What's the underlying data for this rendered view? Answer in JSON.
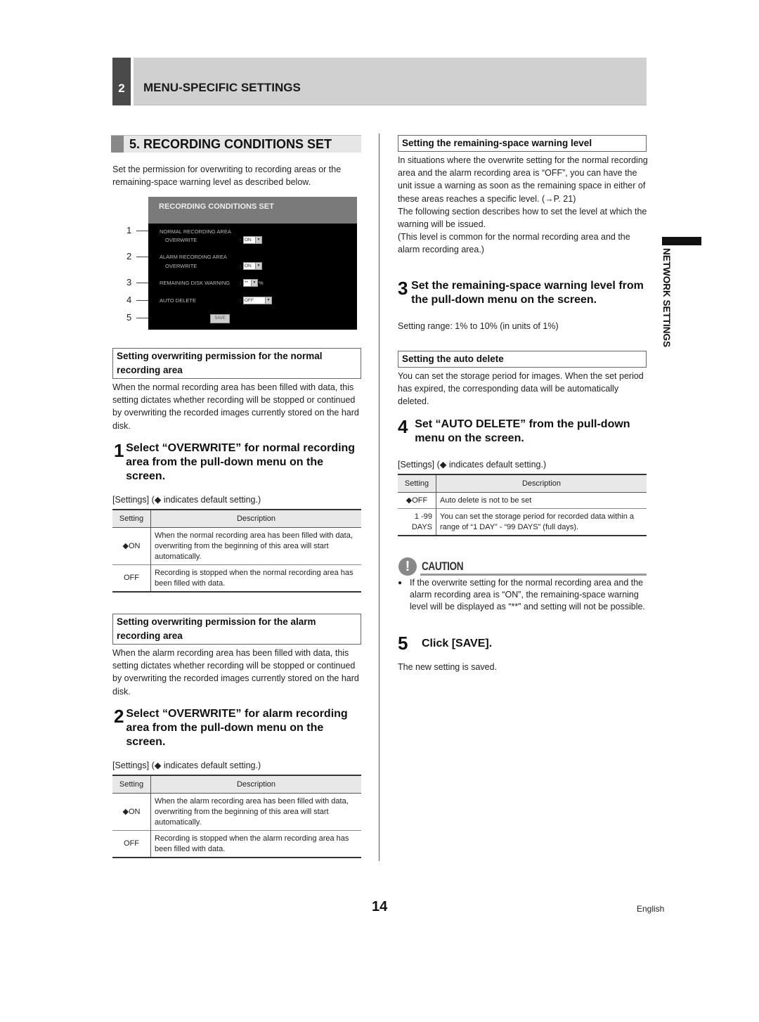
{
  "chapter": {
    "number": "2",
    "title": "MENU-SPECIFIC SETTINGS"
  },
  "section": {
    "title": "5. RECORDING CONDITIONS SET"
  },
  "intro": "Set the permission for overwriting to recording areas or the remaining-space warning level as described below.",
  "screen": {
    "title": "RECORDING CONDITIONS SET",
    "callouts": [
      "1",
      "2",
      "3",
      "4",
      "5"
    ],
    "normal_area_label": "NORMAL RECORDING AREA",
    "normal_overwrite_label": "OVERWRITE",
    "normal_overwrite_value": "ON",
    "alarm_area_label": "ALARM RECORDING AREA",
    "alarm_overwrite_label": "OVERWRITE",
    "alarm_overwrite_value": "ON",
    "disk_warning_label": "REMAINING DISK WARNING",
    "disk_warning_value": "**",
    "disk_warning_unit": "%",
    "auto_delete_label": "AUTO DELETE",
    "auto_delete_value": "OFF",
    "colon": ":",
    "save_label": "SAVE",
    "dropdown_arrow": "▼"
  },
  "normal": {
    "heading": "Setting overwriting permission for the normal recording area",
    "body": "When the normal recording area has been filled with data, this setting dictates whether recording will be stopped or continued by overwriting the recorded images currently stored on the hard disk.",
    "step_num": "1",
    "step_text": "Select “OVERWRITE” for normal recording area from the pull-down menu on the screen.",
    "settings_note": "[Settings] (◆ indicates default setting.)",
    "table": {
      "headers": [
        "Setting",
        "Description"
      ],
      "rows": [
        {
          "setting": "◆ON",
          "desc": "When the normal recording area has been filled with data, overwriting from the beginning of this area will start automatically."
        },
        {
          "setting": "OFF",
          "desc": "Recording is stopped when the normal recording area has been filled with data."
        }
      ]
    }
  },
  "alarm": {
    "heading": "Setting overwriting permission for the alarm recording area",
    "body": "When the alarm recording area has been filled with data, this setting dictates whether recording will be stopped or continued by overwriting the recorded images currently stored on the hard disk.",
    "step_num": "2",
    "step_text": "Select “OVERWRITE” for alarm recording area from the pull-down menu on the screen.",
    "settings_note": "[Settings] (◆ indicates default setting.)",
    "table": {
      "headers": [
        "Setting",
        "Description"
      ],
      "rows": [
        {
          "setting": "◆ON",
          "desc": "When the alarm recording area has been filled with data, overwriting from the beginning of this area will start automatically."
        },
        {
          "setting": "OFF",
          "desc": "Recording is stopped when the alarm recording area has been filled with data."
        }
      ]
    }
  },
  "warning": {
    "heading": "Setting the remaining-space warning level",
    "body1": "In situations where the overwrite setting for the normal recording area and the alarm recording area is “OFF”, you can have the unit issue a warning as soon as the remaining space in either of these areas reaches a specific level. (→P. 21)",
    "body2": "The following section describes how to set the level at which the warning will be issued.",
    "body3": "(This level is common for the normal recording area and the alarm recording area.)",
    "step_num": "3",
    "step_text": "Set the remaining-space warning level from the pull-down menu on the screen.",
    "range": "Setting range: 1% to 10% (in units of 1%)"
  },
  "autodelete": {
    "heading": "Setting the auto delete",
    "body": "You can set the storage period for images. When the set period has expired, the corresponding data will be automatically deleted.",
    "step_num": "4",
    "step_text": "Set “AUTO DELETE” from the pull-down menu on the screen.",
    "settings_note": "[Settings] (◆ indicates default setting.)",
    "table": {
      "headers": [
        "Setting",
        "Description"
      ],
      "rows": [
        {
          "setting": "◆OFF",
          "desc": "Auto delete is not to be set"
        },
        {
          "setting": "1 -99 DAYS",
          "desc": "You can set the storage period for recorded data within a range of  “1 DAY” - “99 DAYS” (full days)."
        }
      ]
    }
  },
  "caution": {
    "icon": "!",
    "label": "CAUTION",
    "bullet": "●",
    "text": "If the overwrite setting for the normal recording area and the alarm recording area is “ON”, the remaining-space warning level will be displayed as “**” and setting will not be possible."
  },
  "save_step": {
    "step_num": "5",
    "step_text": "Click [SAVE].",
    "body": "The new setting is saved."
  },
  "side_tab": {
    "line1": "NETWORK",
    "line2": "SETTINGS"
  },
  "footer": {
    "page_number": "14",
    "language": "English"
  }
}
